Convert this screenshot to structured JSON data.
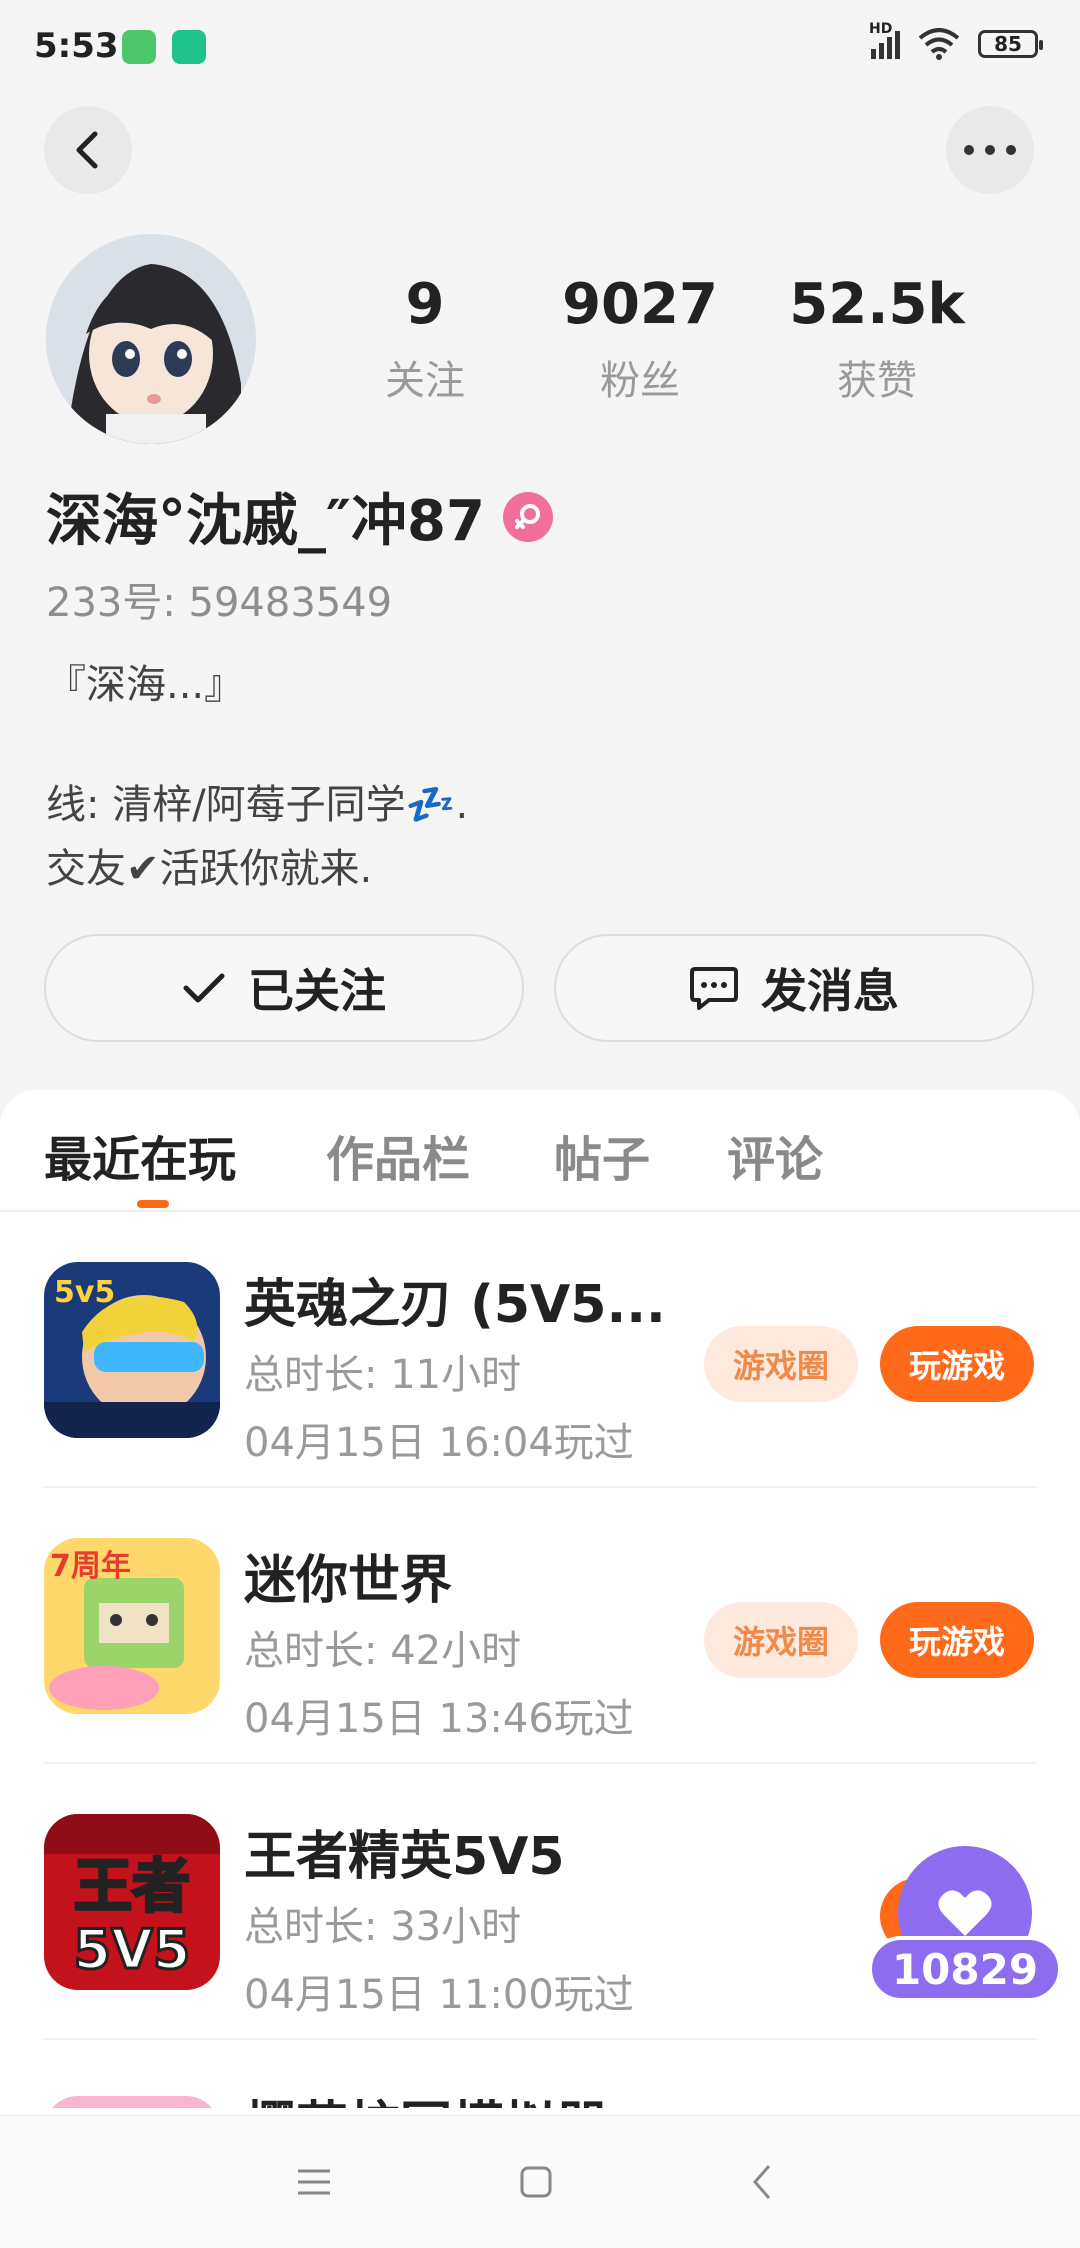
{
  "status_bar": {
    "time": "5:53",
    "battery": "85",
    "network": "HD"
  },
  "profile": {
    "stats": [
      {
        "value": "9",
        "label": "关注"
      },
      {
        "value": "9027",
        "label": "粉丝"
      },
      {
        "value": "52.5k",
        "label": "获赞"
      }
    ],
    "name": "深海°沈戚_″冲87",
    "id_line": "233号: 59483549",
    "bio": [
      "『深海...』",
      "",
      "线: 清梓/阿莓子同学💤.",
      "交友✔活跃你就来."
    ],
    "follow_button": "已关注",
    "message_button": "发消息"
  },
  "tabs": [
    "最近在玩",
    "作品栏",
    "帖子",
    "评论"
  ],
  "games": [
    {
      "name": "英魂之刃 (5V5...",
      "duration": "总时长: 11小时",
      "last_played": "04月15日 16:04玩过",
      "circle": "游戏圈",
      "play": "玩游戏"
    },
    {
      "name": "迷你世界",
      "duration": "总时长: 42小时",
      "last_played": "04月15日 13:46玩过",
      "circle": "游戏圈",
      "play": "玩游戏"
    },
    {
      "name": "王者精英5V5",
      "duration": "总时长: 33小时",
      "last_played": "04月15日 11:00玩过"
    },
    {
      "name": "樱花校园模拟器"
    }
  ],
  "icon_text": {
    "game1_badge": "5v5",
    "game2_badge": "7周年",
    "game3_top": "王者",
    "game3_bottom": "5V5"
  },
  "float_like": {
    "count": "10829"
  },
  "colors": {
    "accent": "#ff6a1a",
    "accent_soft": "#fde9dd",
    "like_bubble": "#8d6cf0",
    "gender": "#f26f9a"
  }
}
